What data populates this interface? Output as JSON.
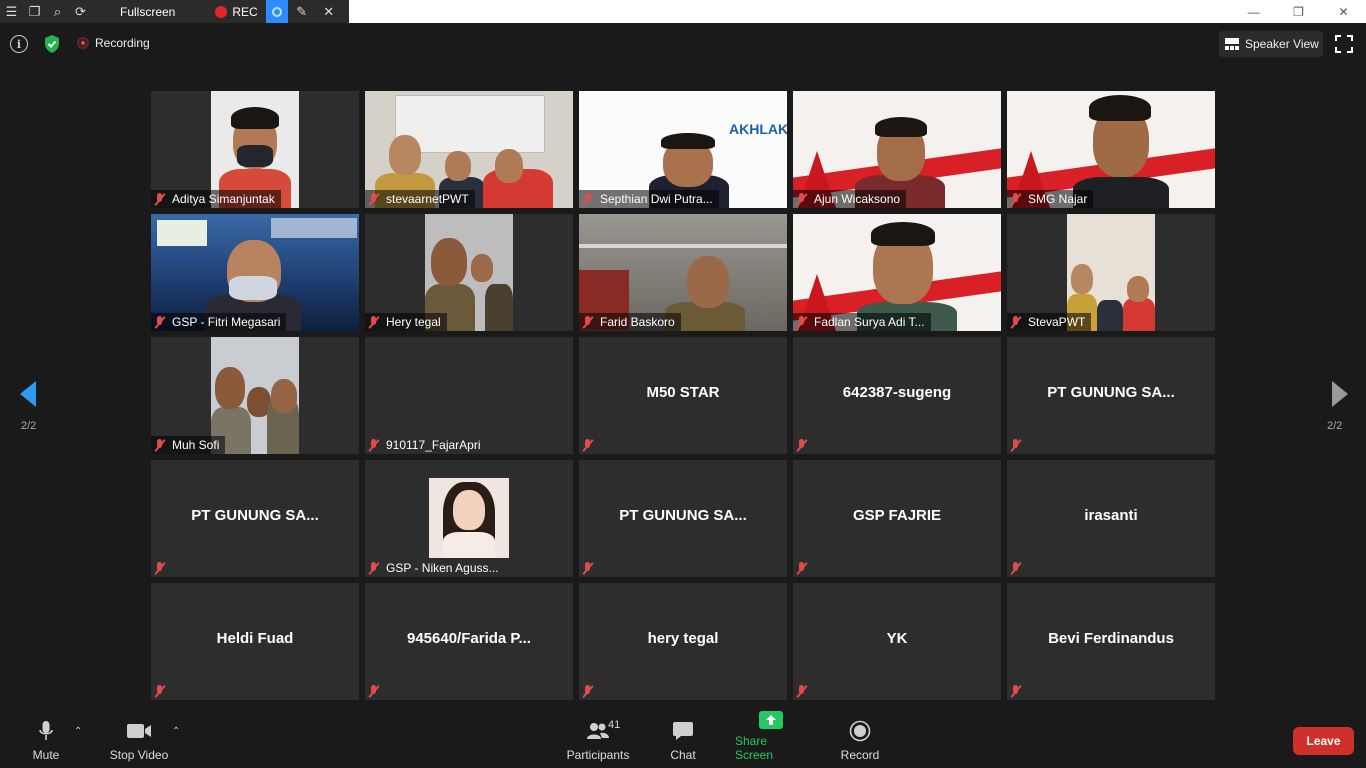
{
  "window": {
    "recording_toolbar": {
      "fullscreen_label": "Fullscreen",
      "rec_label": "REC"
    }
  },
  "header": {
    "recording_label": "Recording",
    "speaker_view_label": "Speaker View"
  },
  "navigation": {
    "left_page": "2/2",
    "right_page": "2/2"
  },
  "participants": [
    {
      "name": "Aditya Simanjuntak",
      "video": true
    },
    {
      "name": "stevaarnetPWT",
      "video": true
    },
    {
      "name": "Septhian Dwi Putra...",
      "video": true
    },
    {
      "name": "Ajun Wicaksono",
      "video": true
    },
    {
      "name": "SMG Najar",
      "video": true
    },
    {
      "name": "GSP - Fitri Megasari",
      "video": true
    },
    {
      "name": "Hery tegal",
      "video": true
    },
    {
      "name": "Farid Baskoro",
      "video": true
    },
    {
      "name": "Fadlan Surya Adi T...",
      "video": true
    },
    {
      "name": "StevaPWT",
      "video": true
    },
    {
      "name": "Muh Sofi",
      "video": true
    },
    {
      "name": "910117_FajarApri",
      "video": false
    },
    {
      "name": "M50 STAR",
      "video": false
    },
    {
      "name": "642387-sugeng",
      "video": false
    },
    {
      "name": "PT GUNUNG SA...",
      "video": false
    },
    {
      "name": "PT GUNUNG SA...",
      "video": false
    },
    {
      "name": "GSP - Niken Aguss...",
      "video": true
    },
    {
      "name": "PT GUNUNG SA...",
      "video": false
    },
    {
      "name": "GSP FAJRIE",
      "video": false
    },
    {
      "name": "irasanti",
      "video": false
    },
    {
      "name": "Heldi Fuad",
      "video": false
    },
    {
      "name": "945640/Farida P...",
      "video": false
    },
    {
      "name": "hery tegal",
      "video": false
    },
    {
      "name": "YK",
      "video": false
    },
    {
      "name": "Bevi Ferdinandus",
      "video": false
    }
  ],
  "toolbar": {
    "mute_label": "Mute",
    "stop_video_label": "Stop Video",
    "participants_label": "Participants",
    "participants_count": "41",
    "chat_label": "Chat",
    "share_screen_label": "Share Screen",
    "record_label": "Record",
    "leave_label": "Leave"
  },
  "colors": {
    "share_green": "#25c95f",
    "leave_red": "#d0302a",
    "accent_blue": "#2d8cff",
    "muted_red": "#e24b4b"
  }
}
